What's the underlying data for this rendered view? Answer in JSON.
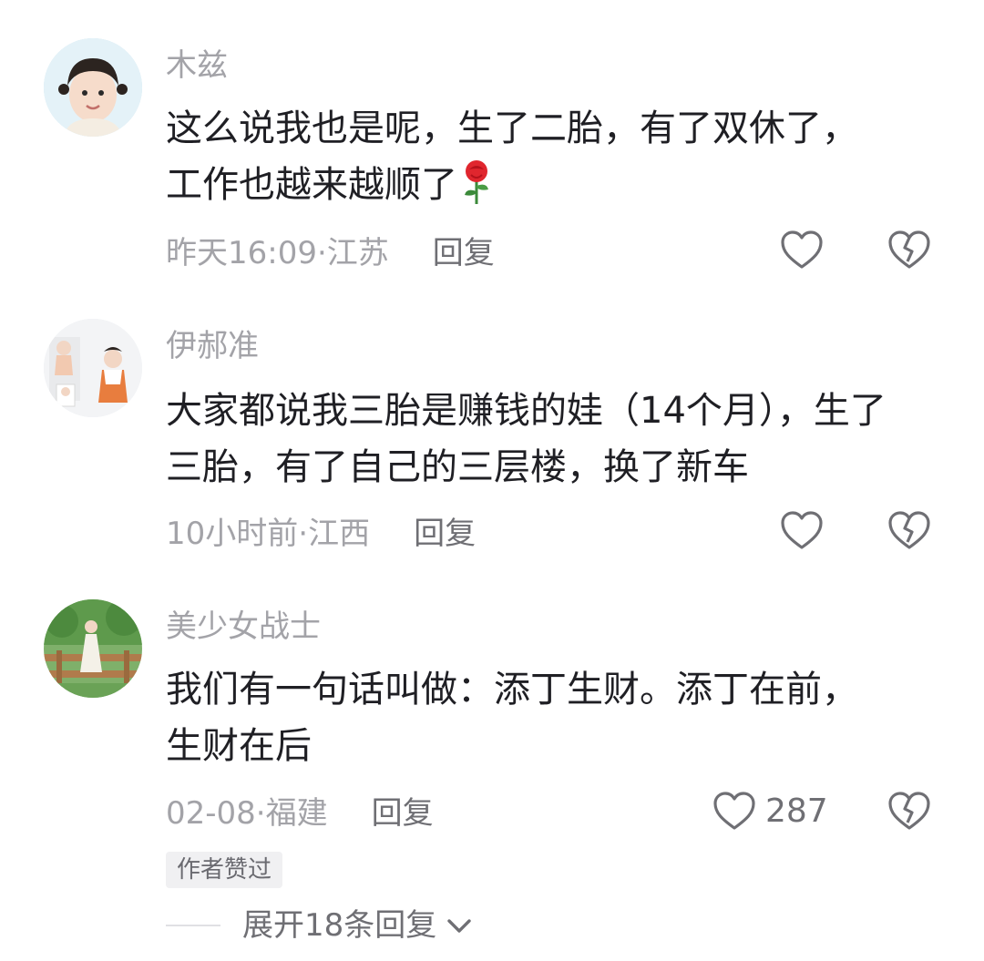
{
  "comments": [
    {
      "username": "木兹",
      "text": "这么说我也是呢，生了二胎，有了双休了，工作也越来越顺了",
      "time": "昨天16:09",
      "location": "江苏",
      "reply_label": "回复",
      "like_count": "",
      "rose_emoji": "rose"
    },
    {
      "username": "伊郝准",
      "text": "大家都说我三胎是赚钱的娃（14个月），生了三胎，有了自己的三层楼，换了新车",
      "time": "10小时前",
      "location": "江西",
      "reply_label": "回复",
      "like_count": ""
    },
    {
      "username": "美少女战士",
      "text": "我们有一句话叫做：添丁生财。添丁在前，生财在后",
      "time": "02-08",
      "location": "福建",
      "reply_label": "回复",
      "like_count": "287",
      "badge": "作者赞过",
      "expand_label": "展开18条回复"
    }
  ],
  "separator": " · ",
  "icons": {
    "like": "heart-outline-icon",
    "dislike": "broken-heart-icon",
    "expand": "chevron-down-icon"
  },
  "colors": {
    "secondary_text": "#a3a3a8",
    "primary_text": "#1f1f24",
    "action_text": "#6f6f74"
  }
}
